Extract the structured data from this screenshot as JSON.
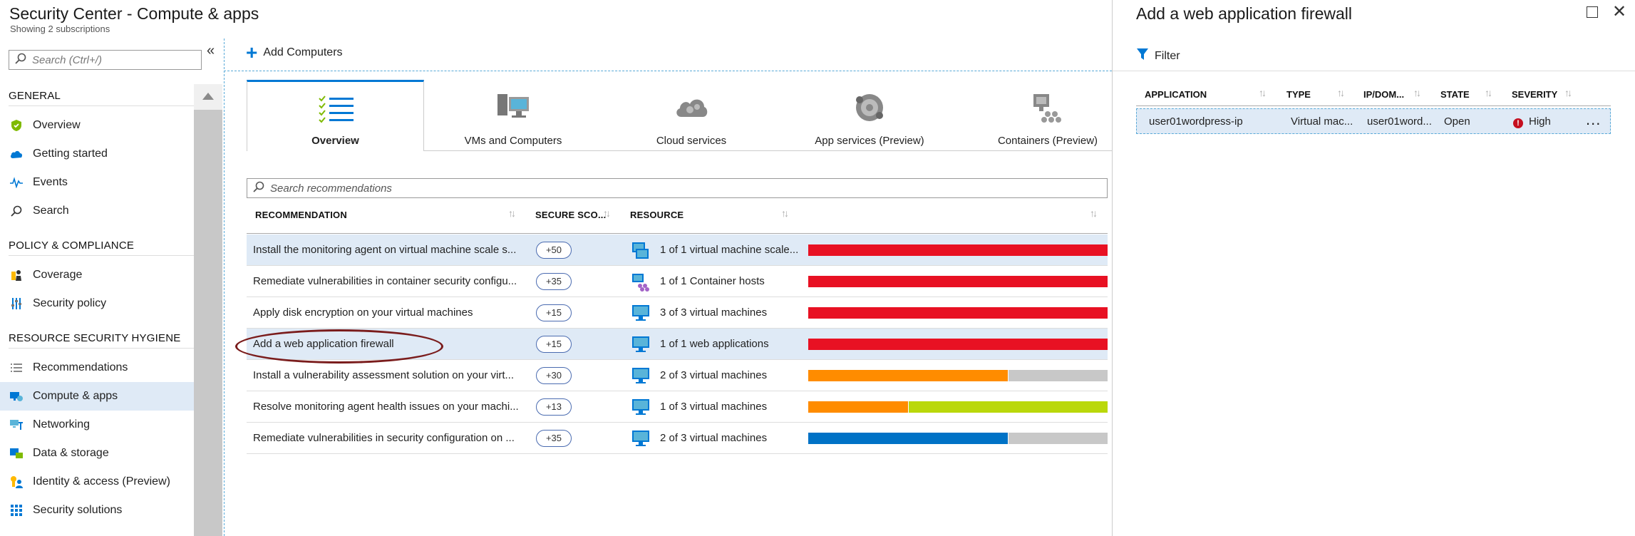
{
  "header": {
    "title": "Security Center - Compute & apps",
    "subtitle": "Showing 2 subscriptions"
  },
  "sidebar": {
    "search_placeholder": "Search (Ctrl+/)",
    "collapse_label": "«",
    "sections": [
      {
        "heading": "GENERAL",
        "items": [
          "Overview",
          "Getting started",
          "Events",
          "Search"
        ]
      },
      {
        "heading": "POLICY & COMPLIANCE",
        "items": [
          "Coverage",
          "Security policy"
        ]
      },
      {
        "heading": "RESOURCE SECURITY HYGIENE",
        "items": [
          "Recommendations",
          "Compute & apps",
          "Networking",
          "Data & storage",
          "Identity & access (Preview)",
          "Security solutions"
        ]
      }
    ],
    "active_item": "Compute & apps"
  },
  "main": {
    "add_button": "Add Computers",
    "tabs": [
      "Overview",
      "VMs and Computers",
      "Cloud services",
      "App services (Preview)",
      "Containers (Preview)"
    ],
    "search_placeholder": "Search recommendations",
    "columns": [
      "RECOMMENDATION",
      "SECURE SCO...",
      "RESOURCE"
    ],
    "rows": [
      {
        "recommendation": "Install the monitoring agent on virtual machine scale s...",
        "score": "+50",
        "resource": "1 of 1 virtual machine scale...",
        "bar": [
          {
            "color": "#e81123",
            "frac": 1.0
          }
        ]
      },
      {
        "recommendation": "Remediate vulnerabilities in container security configu...",
        "score": "+35",
        "resource": "1 of 1 Container hosts",
        "bar": [
          {
            "color": "#e81123",
            "frac": 1.0
          }
        ]
      },
      {
        "recommendation": "Apply disk encryption on your virtual machines",
        "score": "+15",
        "resource": "3 of 3 virtual machines",
        "bar": [
          {
            "color": "#e81123",
            "frac": 1.0
          }
        ]
      },
      {
        "recommendation": "Add a web application firewall",
        "score": "+15",
        "resource": "1 of 1 web applications",
        "bar": [
          {
            "color": "#e81123",
            "frac": 1.0
          }
        ]
      },
      {
        "recommendation": "Install a vulnerability assessment solution on your virt...",
        "score": "+30",
        "resource": "2 of 3 virtual machines",
        "bar": [
          {
            "color": "#ff8c00",
            "frac": 0.667
          },
          {
            "color": "#c8c8c8",
            "frac": 0.333
          }
        ]
      },
      {
        "recommendation": "Resolve monitoring agent health issues on your machi...",
        "score": "+13",
        "resource": "1 of 3 virtual machines",
        "bar": [
          {
            "color": "#ff8c00",
            "frac": 0.333
          },
          {
            "color": "#bad80a",
            "frac": 0.667
          }
        ]
      },
      {
        "recommendation": "Remediate vulnerabilities in security configuration on ...",
        "score": "+35",
        "resource": "2 of 3 virtual machines",
        "bar": [
          {
            "color": "#0072c6",
            "frac": 0.667
          },
          {
            "color": "#c8c8c8",
            "frac": 0.333
          }
        ]
      }
    ]
  },
  "blade": {
    "title": "Add a web application firewall",
    "filter_label": "Filter",
    "columns": [
      "APPLICATION",
      "TYPE",
      "IP/DOM...",
      "STATE",
      "SEVERITY"
    ],
    "row": {
      "application": "user01wordpress-ip",
      "type": "Virtual mac...",
      "ip": "user01word...",
      "state": "Open",
      "severity": "High",
      "more": "..."
    }
  }
}
